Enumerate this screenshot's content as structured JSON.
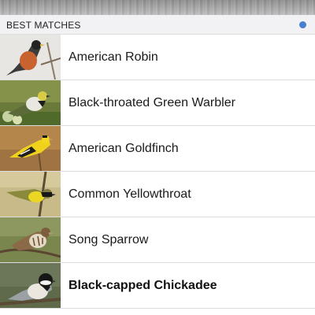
{
  "section": {
    "title": "BEST MATCHES",
    "indicator_color": "#4a7fd0"
  },
  "matches": [
    {
      "name": "American Robin",
      "icon": "american-robin-photo",
      "selected": false
    },
    {
      "name": "Black-throated Green Warbler",
      "icon": "black-throated-green-warbler-photo",
      "selected": false
    },
    {
      "name": "American Goldfinch",
      "icon": "american-goldfinch-photo",
      "selected": false
    },
    {
      "name": "Common Yellowthroat",
      "icon": "common-yellowthroat-photo",
      "selected": false
    },
    {
      "name": "Song Sparrow",
      "icon": "song-sparrow-photo",
      "selected": false
    },
    {
      "name": "Black-capped Chickadee",
      "icon": "black-capped-chickadee-photo",
      "selected": true
    }
  ]
}
